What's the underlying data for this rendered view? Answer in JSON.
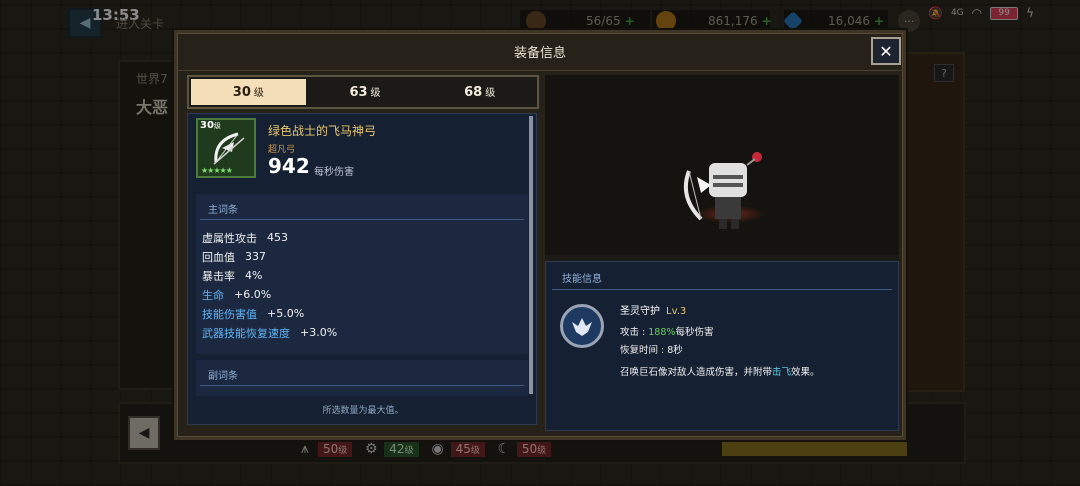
{
  "status_bar": {
    "time": "13:53",
    "resources": [
      {
        "name": "stamina",
        "icon": "coffee-icon",
        "value": "56/65",
        "color": "#7a5a3a"
      },
      {
        "name": "gold",
        "icon": "gold-coin-icon",
        "value": "861,176",
        "color": "#c98a2a"
      },
      {
        "name": "gems",
        "icon": "gem-icon",
        "value": "16,046",
        "color": "#3a8ad0"
      }
    ],
    "battery": "99",
    "network": "4G"
  },
  "background": {
    "back_label": "进入关卡",
    "world_label": "世界7",
    "stage_label": "大恶",
    "help_label": "?",
    "bottom_levels": [
      {
        "icon": "claw-icon",
        "level": "50",
        "unit": "级",
        "style": "red"
      },
      {
        "icon": "gear-icon",
        "level": "42",
        "unit": "级",
        "style": "green"
      },
      {
        "icon": "panda-icon",
        "level": "45",
        "unit": "级",
        "style": "red"
      },
      {
        "icon": "moon-icon",
        "level": "50",
        "unit": "级",
        "style": "red"
      }
    ]
  },
  "modal": {
    "title": "装备信息",
    "close_label": "✕",
    "tabs": [
      {
        "level": "30",
        "unit": "级",
        "active": true
      },
      {
        "level": "63",
        "unit": "级",
        "active": false
      },
      {
        "level": "68",
        "unit": "级",
        "active": false
      }
    ],
    "item": {
      "level": "30",
      "level_unit": "级",
      "stars": "★★★★★",
      "name": "绿色战士的飞马神弓",
      "grade": "超凡弓",
      "dps_value": "942",
      "dps_label": "每秒伤害"
    },
    "main_stats": {
      "header": "主词条",
      "rows": [
        {
          "name": "虚属性攻击",
          "value": "453",
          "blue": false
        },
        {
          "name": "回血值",
          "value": "337",
          "blue": false
        },
        {
          "name": "暴击率",
          "value": "4%",
          "blue": false
        },
        {
          "name": "生命",
          "value": "+6.0%",
          "blue": true
        },
        {
          "name": "技能伤害值",
          "value": "+5.0%",
          "blue": true
        },
        {
          "name": "武器技能恢复速度",
          "value": "+3.0%",
          "blue": true
        }
      ]
    },
    "sub_stats": {
      "header": "副词条"
    },
    "footer_note": "所选数量为最大值。",
    "skill": {
      "header": "技能信息",
      "name": "圣灵守护",
      "level": "Lv.3",
      "attack_label": "攻击 :",
      "attack_pct": "188%",
      "attack_suffix": "每秒伤害",
      "cooldown_label": "恢复时间 :",
      "cooldown_value": "8秒",
      "desc_before": "召唤巨石像对敌人造成伤害，并附带",
      "desc_highlight": "击飞",
      "desc_after": "效果。"
    }
  }
}
